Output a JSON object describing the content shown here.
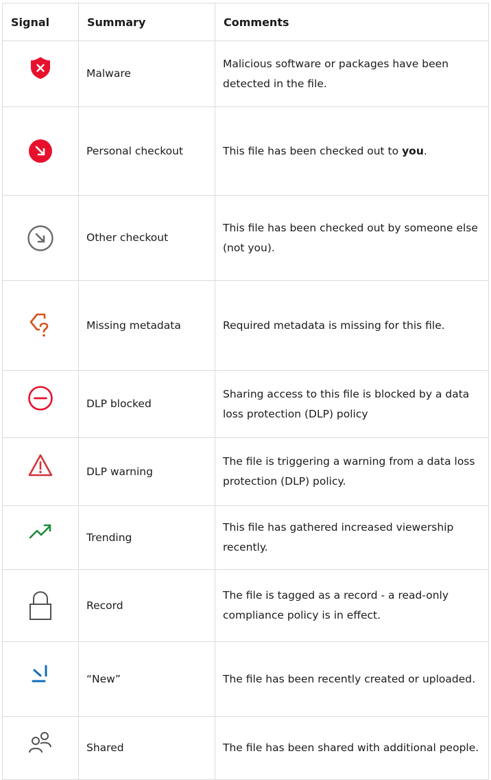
{
  "header": {
    "signal": "Signal",
    "summary": "Summary",
    "comments": "Comments"
  },
  "rows": [
    {
      "icon": "malware-shield-icon",
      "color": "#e8112d",
      "summary": "Malware",
      "comment": "Malicious software or packages have been detected in the file."
    },
    {
      "icon": "personal-checkout-icon",
      "color": "#e8112d",
      "summary": "Personal checkout",
      "comment_pre": "This file has been checked out to ",
      "comment_bold": "you",
      "comment_post": "."
    },
    {
      "icon": "other-checkout-icon",
      "color": "#6b6b6b",
      "summary": "Other checkout",
      "comment": "This file has been checked out by someone else (not you)."
    },
    {
      "icon": "missing-metadata-icon",
      "color": "#d8501c",
      "summary": "Missing metadata",
      "comment": "Required metadata is missing for this file."
    },
    {
      "icon": "dlp-blocked-icon",
      "color": "#e8112d",
      "summary": "DLP blocked",
      "comment": "Sharing access to this file is blocked by a data loss protection (DLP) policy"
    },
    {
      "icon": "dlp-warning-icon",
      "color": "#d13438",
      "summary": "DLP warning",
      "comment": "The file is triggering a warning from a data loss protection (DLP) policy."
    },
    {
      "icon": "trending-icon",
      "color": "#1e8a3a",
      "summary": "Trending",
      "comment": "This file has gathered increased viewership recently."
    },
    {
      "icon": "record-lock-icon",
      "color": "#505050",
      "summary": "Record",
      "comment": "The file is tagged as a record - a read-only compliance policy is in effect."
    },
    {
      "icon": "new-file-icon",
      "color": "#0f6cbd",
      "summary": "“New”",
      "comment": "The file has been recently created or uploaded."
    },
    {
      "icon": "shared-people-icon",
      "color": "#505050",
      "summary": "Shared",
      "comment": "The file has been shared with additional people."
    }
  ]
}
